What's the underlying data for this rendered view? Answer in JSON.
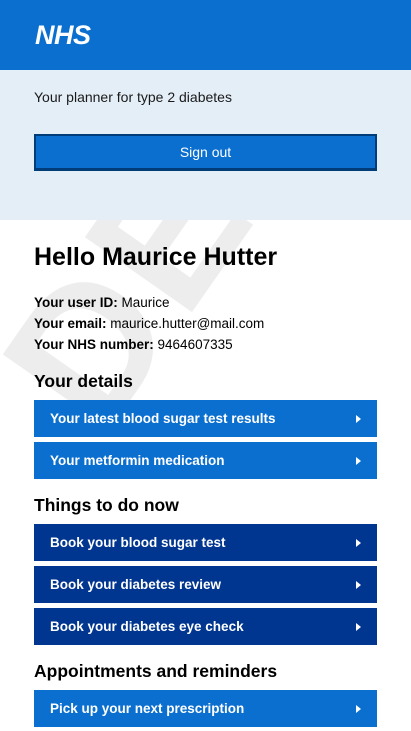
{
  "header": {
    "logo_text": "NHS"
  },
  "planner": {
    "text": "Your planner for type 2 diabetes",
    "signout_label": "Sign out"
  },
  "main": {
    "watermark": "DEMO",
    "greeting": "Hello Maurice Hutter",
    "user_id_label": "Your user ID:",
    "user_id": "Maurice",
    "email_label": "Your email:",
    "email": "maurice.hutter@mail.com",
    "nhs_label": "Your NHS number:",
    "nhs_number": "9464607335"
  },
  "sections": [
    {
      "title": "Your details",
      "items": [
        "Your latest blood sugar test results",
        "Your metformin medication"
      ]
    },
    {
      "title": "Things to do now",
      "items": [
        "Book your blood sugar test",
        "Book your diabetes review",
        "Book your diabetes eye check"
      ]
    },
    {
      "title": "Appointments and reminders",
      "items": [
        "Pick up your next prescription"
      ]
    }
  ],
  "colors": {
    "brand_blue": "#0b6fd0",
    "dark_blue": "#003590",
    "light_bg": "#e4eef7"
  },
  "icons": {
    "nav_arrow": "chevron-right-icon"
  }
}
